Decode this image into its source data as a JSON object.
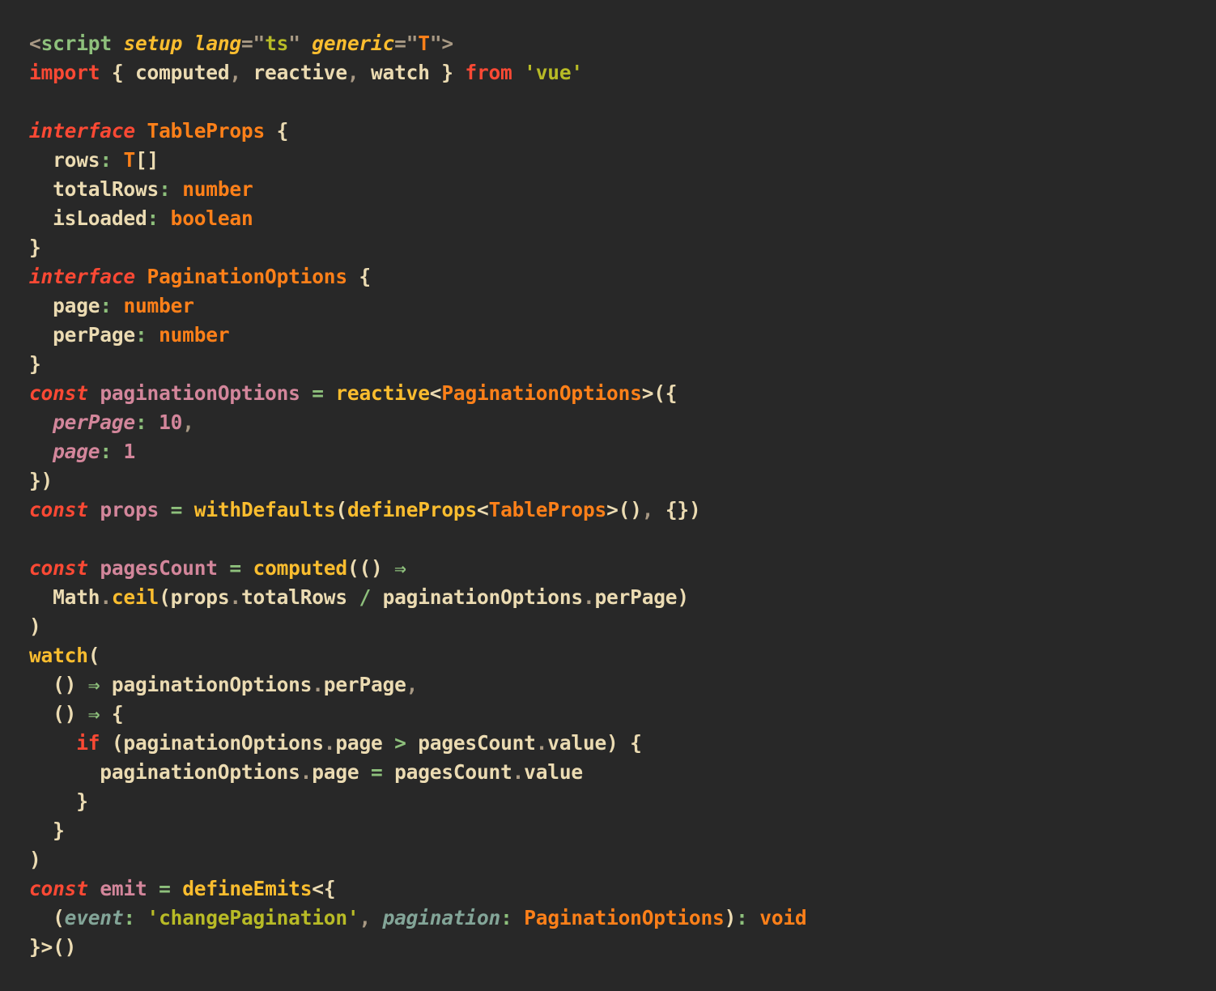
{
  "editor": {
    "language": "vue-typescript",
    "theme": "gruvbox-dark",
    "background_color": "#282828",
    "default_text_color": "#ebdbb2",
    "font_size_px": 24.5,
    "line_height_px": 36,
    "total_lines": 33
  },
  "palette": {
    "keyword": "#fb4934",
    "tag": "#8ec07c",
    "type": "#fe8019",
    "function": "#fabd2f",
    "string": "#b8bb26",
    "variable": "#d3869b",
    "number": "#d3869b",
    "operator": "#8ec07c",
    "parameter": "#83a598",
    "punctuation": "#a89984",
    "plain": "#ebdbb2"
  },
  "code": {
    "lines": [
      {
        "n": 1,
        "tokens": [
          {
            "t": "<",
            "c": "t-punct"
          },
          {
            "t": "script",
            "c": "t-tag"
          },
          {
            "t": " ",
            "c": "t-plain"
          },
          {
            "t": "setup",
            "c": "t-attr"
          },
          {
            "t": " ",
            "c": "t-plain"
          },
          {
            "t": "lang",
            "c": "t-attr"
          },
          {
            "t": "=\"",
            "c": "t-punct"
          },
          {
            "t": "ts",
            "c": "t-string"
          },
          {
            "t": "\" ",
            "c": "t-punct"
          },
          {
            "t": "generic",
            "c": "t-attr"
          },
          {
            "t": "=\"",
            "c": "t-punct"
          },
          {
            "t": "T",
            "c": "t-type"
          },
          {
            "t": "\">",
            "c": "t-punct"
          }
        ]
      },
      {
        "n": 2,
        "tokens": [
          {
            "t": "import",
            "c": "t-keyword"
          },
          {
            "t": " { ",
            "c": "t-plain"
          },
          {
            "t": "computed",
            "c": "t-plain"
          },
          {
            "t": ",",
            "c": "t-punct"
          },
          {
            "t": " reactive",
            "c": "t-plain"
          },
          {
            "t": ",",
            "c": "t-punct"
          },
          {
            "t": " watch } ",
            "c": "t-plain"
          },
          {
            "t": "from",
            "c": "t-keyword"
          },
          {
            "t": " ",
            "c": "t-plain"
          },
          {
            "t": "'vue'",
            "c": "t-string"
          }
        ]
      },
      {
        "n": 3,
        "tokens": []
      },
      {
        "n": 4,
        "tokens": [
          {
            "t": "interface",
            "c": "t-keyword-i"
          },
          {
            "t": " ",
            "c": "t-plain"
          },
          {
            "t": "TableProps",
            "c": "t-type"
          },
          {
            "t": " {",
            "c": "t-plain"
          }
        ]
      },
      {
        "n": 5,
        "tokens": [
          {
            "t": "  rows",
            "c": "t-plain"
          },
          {
            "t": ":",
            "c": "t-colon"
          },
          {
            "t": " ",
            "c": "t-plain"
          },
          {
            "t": "T",
            "c": "t-type"
          },
          {
            "t": "[]",
            "c": "t-plain"
          }
        ]
      },
      {
        "n": 6,
        "tokens": [
          {
            "t": "  totalRows",
            "c": "t-plain"
          },
          {
            "t": ":",
            "c": "t-colon"
          },
          {
            "t": " ",
            "c": "t-plain"
          },
          {
            "t": "number",
            "c": "t-type"
          }
        ]
      },
      {
        "n": 7,
        "tokens": [
          {
            "t": "  isLoaded",
            "c": "t-plain"
          },
          {
            "t": ":",
            "c": "t-colon"
          },
          {
            "t": " ",
            "c": "t-plain"
          },
          {
            "t": "boolean",
            "c": "t-type"
          }
        ]
      },
      {
        "n": 8,
        "tokens": [
          {
            "t": "}",
            "c": "t-plain"
          }
        ]
      },
      {
        "n": 9,
        "tokens": [
          {
            "t": "interface",
            "c": "t-keyword-i"
          },
          {
            "t": " ",
            "c": "t-plain"
          },
          {
            "t": "PaginationOptions",
            "c": "t-type"
          },
          {
            "t": " {",
            "c": "t-plain"
          }
        ]
      },
      {
        "n": 10,
        "tokens": [
          {
            "t": "  page",
            "c": "t-plain"
          },
          {
            "t": ":",
            "c": "t-colon"
          },
          {
            "t": " ",
            "c": "t-plain"
          },
          {
            "t": "number",
            "c": "t-type"
          }
        ]
      },
      {
        "n": 11,
        "tokens": [
          {
            "t": "  perPage",
            "c": "t-plain"
          },
          {
            "t": ":",
            "c": "t-colon"
          },
          {
            "t": " ",
            "c": "t-plain"
          },
          {
            "t": "number",
            "c": "t-type"
          }
        ]
      },
      {
        "n": 12,
        "tokens": [
          {
            "t": "}",
            "c": "t-plain"
          }
        ]
      },
      {
        "n": 13,
        "tokens": [
          {
            "t": "const",
            "c": "t-keyword-i"
          },
          {
            "t": " ",
            "c": "t-plain"
          },
          {
            "t": "paginationOptions",
            "c": "t-var"
          },
          {
            "t": " ",
            "c": "t-plain"
          },
          {
            "t": "=",
            "c": "t-op"
          },
          {
            "t": " ",
            "c": "t-plain"
          },
          {
            "t": "reactive",
            "c": "t-func"
          },
          {
            "t": "<",
            "c": "t-plain"
          },
          {
            "t": "PaginationOptions",
            "c": "t-type"
          },
          {
            "t": ">({",
            "c": "t-plain"
          }
        ]
      },
      {
        "n": 14,
        "tokens": [
          {
            "t": "  ",
            "c": "t-plain"
          },
          {
            "t": "perPage",
            "c": "t-var-i"
          },
          {
            "t": ":",
            "c": "t-colon"
          },
          {
            "t": " ",
            "c": "t-plain"
          },
          {
            "t": "10",
            "c": "t-number"
          },
          {
            "t": ",",
            "c": "t-punct"
          }
        ]
      },
      {
        "n": 15,
        "tokens": [
          {
            "t": "  ",
            "c": "t-plain"
          },
          {
            "t": "page",
            "c": "t-var-i"
          },
          {
            "t": ":",
            "c": "t-colon"
          },
          {
            "t": " ",
            "c": "t-plain"
          },
          {
            "t": "1",
            "c": "t-number"
          }
        ]
      },
      {
        "n": 16,
        "tokens": [
          {
            "t": "})",
            "c": "t-plain"
          }
        ]
      },
      {
        "n": 17,
        "tokens": [
          {
            "t": "const",
            "c": "t-keyword-i"
          },
          {
            "t": " ",
            "c": "t-plain"
          },
          {
            "t": "props",
            "c": "t-var"
          },
          {
            "t": " ",
            "c": "t-plain"
          },
          {
            "t": "=",
            "c": "t-op"
          },
          {
            "t": " ",
            "c": "t-plain"
          },
          {
            "t": "withDefaults",
            "c": "t-func"
          },
          {
            "t": "(",
            "c": "t-plain"
          },
          {
            "t": "defineProps",
            "c": "t-func"
          },
          {
            "t": "<",
            "c": "t-plain"
          },
          {
            "t": "TableProps",
            "c": "t-type"
          },
          {
            "t": ">()",
            "c": "t-plain"
          },
          {
            "t": ",",
            "c": "t-punct"
          },
          {
            "t": " {})",
            "c": "t-plain"
          }
        ]
      },
      {
        "n": 18,
        "tokens": []
      },
      {
        "n": 19,
        "tokens": [
          {
            "t": "const",
            "c": "t-keyword-i"
          },
          {
            "t": " ",
            "c": "t-plain"
          },
          {
            "t": "pagesCount",
            "c": "t-var"
          },
          {
            "t": " ",
            "c": "t-plain"
          },
          {
            "t": "=",
            "c": "t-op"
          },
          {
            "t": " ",
            "c": "t-plain"
          },
          {
            "t": "computed",
            "c": "t-func"
          },
          {
            "t": "(() ",
            "c": "t-plain"
          },
          {
            "t": "⇒",
            "c": "t-op"
          }
        ]
      },
      {
        "n": 20,
        "tokens": [
          {
            "t": "  Math",
            "c": "t-plain"
          },
          {
            "t": ".",
            "c": "t-punct"
          },
          {
            "t": "ceil",
            "c": "t-func"
          },
          {
            "t": "(props",
            "c": "t-plain"
          },
          {
            "t": ".",
            "c": "t-punct"
          },
          {
            "t": "totalRows ",
            "c": "t-plain"
          },
          {
            "t": "/",
            "c": "t-op"
          },
          {
            "t": " paginationOptions",
            "c": "t-plain"
          },
          {
            "t": ".",
            "c": "t-punct"
          },
          {
            "t": "perPage)",
            "c": "t-plain"
          }
        ]
      },
      {
        "n": 21,
        "tokens": [
          {
            "t": ")",
            "c": "t-plain"
          }
        ]
      },
      {
        "n": 22,
        "tokens": [
          {
            "t": "watch",
            "c": "t-func"
          },
          {
            "t": "(",
            "c": "t-plain"
          }
        ]
      },
      {
        "n": 23,
        "tokens": [
          {
            "t": "  () ",
            "c": "t-plain"
          },
          {
            "t": "⇒",
            "c": "t-op"
          },
          {
            "t": " paginationOptions",
            "c": "t-plain"
          },
          {
            "t": ".",
            "c": "t-punct"
          },
          {
            "t": "perPage",
            "c": "t-plain"
          },
          {
            "t": ",",
            "c": "t-punct"
          }
        ]
      },
      {
        "n": 24,
        "tokens": [
          {
            "t": "  () ",
            "c": "t-plain"
          },
          {
            "t": "⇒",
            "c": "t-op"
          },
          {
            "t": " {",
            "c": "t-plain"
          }
        ]
      },
      {
        "n": 25,
        "tokens": [
          {
            "t": "    ",
            "c": "t-plain"
          },
          {
            "t": "if",
            "c": "t-keyword"
          },
          {
            "t": " (paginationOptions",
            "c": "t-plain"
          },
          {
            "t": ".",
            "c": "t-punct"
          },
          {
            "t": "page ",
            "c": "t-plain"
          },
          {
            "t": ">",
            "c": "t-op"
          },
          {
            "t": " pagesCount",
            "c": "t-plain"
          },
          {
            "t": ".",
            "c": "t-punct"
          },
          {
            "t": "value) {",
            "c": "t-plain"
          }
        ]
      },
      {
        "n": 26,
        "tokens": [
          {
            "t": "      paginationOptions",
            "c": "t-plain"
          },
          {
            "t": ".",
            "c": "t-punct"
          },
          {
            "t": "page ",
            "c": "t-plain"
          },
          {
            "t": "=",
            "c": "t-op"
          },
          {
            "t": " pagesCount",
            "c": "t-plain"
          },
          {
            "t": ".",
            "c": "t-punct"
          },
          {
            "t": "value",
            "c": "t-plain"
          }
        ]
      },
      {
        "n": 27,
        "tokens": [
          {
            "t": "    }",
            "c": "t-plain"
          }
        ]
      },
      {
        "n": 28,
        "tokens": [
          {
            "t": "  }",
            "c": "t-plain"
          }
        ]
      },
      {
        "n": 29,
        "tokens": [
          {
            "t": ")",
            "c": "t-plain"
          }
        ]
      },
      {
        "n": 30,
        "tokens": [
          {
            "t": "const",
            "c": "t-keyword-i"
          },
          {
            "t": " ",
            "c": "t-plain"
          },
          {
            "t": "emit",
            "c": "t-var"
          },
          {
            "t": " ",
            "c": "t-plain"
          },
          {
            "t": "=",
            "c": "t-op"
          },
          {
            "t": " ",
            "c": "t-plain"
          },
          {
            "t": "defineEmits",
            "c": "t-func"
          },
          {
            "t": "<{",
            "c": "t-plain"
          }
        ]
      },
      {
        "n": 31,
        "tokens": [
          {
            "t": "  (",
            "c": "t-plain"
          },
          {
            "t": "event",
            "c": "t-param"
          },
          {
            "t": ":",
            "c": "t-colon"
          },
          {
            "t": " ",
            "c": "t-plain"
          },
          {
            "t": "'changePagination'",
            "c": "t-string"
          },
          {
            "t": ",",
            "c": "t-punct"
          },
          {
            "t": " ",
            "c": "t-plain"
          },
          {
            "t": "pagination",
            "c": "t-param"
          },
          {
            "t": ":",
            "c": "t-colon"
          },
          {
            "t": " ",
            "c": "t-plain"
          },
          {
            "t": "PaginationOptions",
            "c": "t-type"
          },
          {
            "t": ")",
            "c": "t-plain"
          },
          {
            "t": ":",
            "c": "t-colon"
          },
          {
            "t": " ",
            "c": "t-plain"
          },
          {
            "t": "void",
            "c": "t-type"
          }
        ]
      },
      {
        "n": 32,
        "tokens": [
          {
            "t": "}>()",
            "c": "t-plain"
          }
        ]
      }
    ]
  }
}
